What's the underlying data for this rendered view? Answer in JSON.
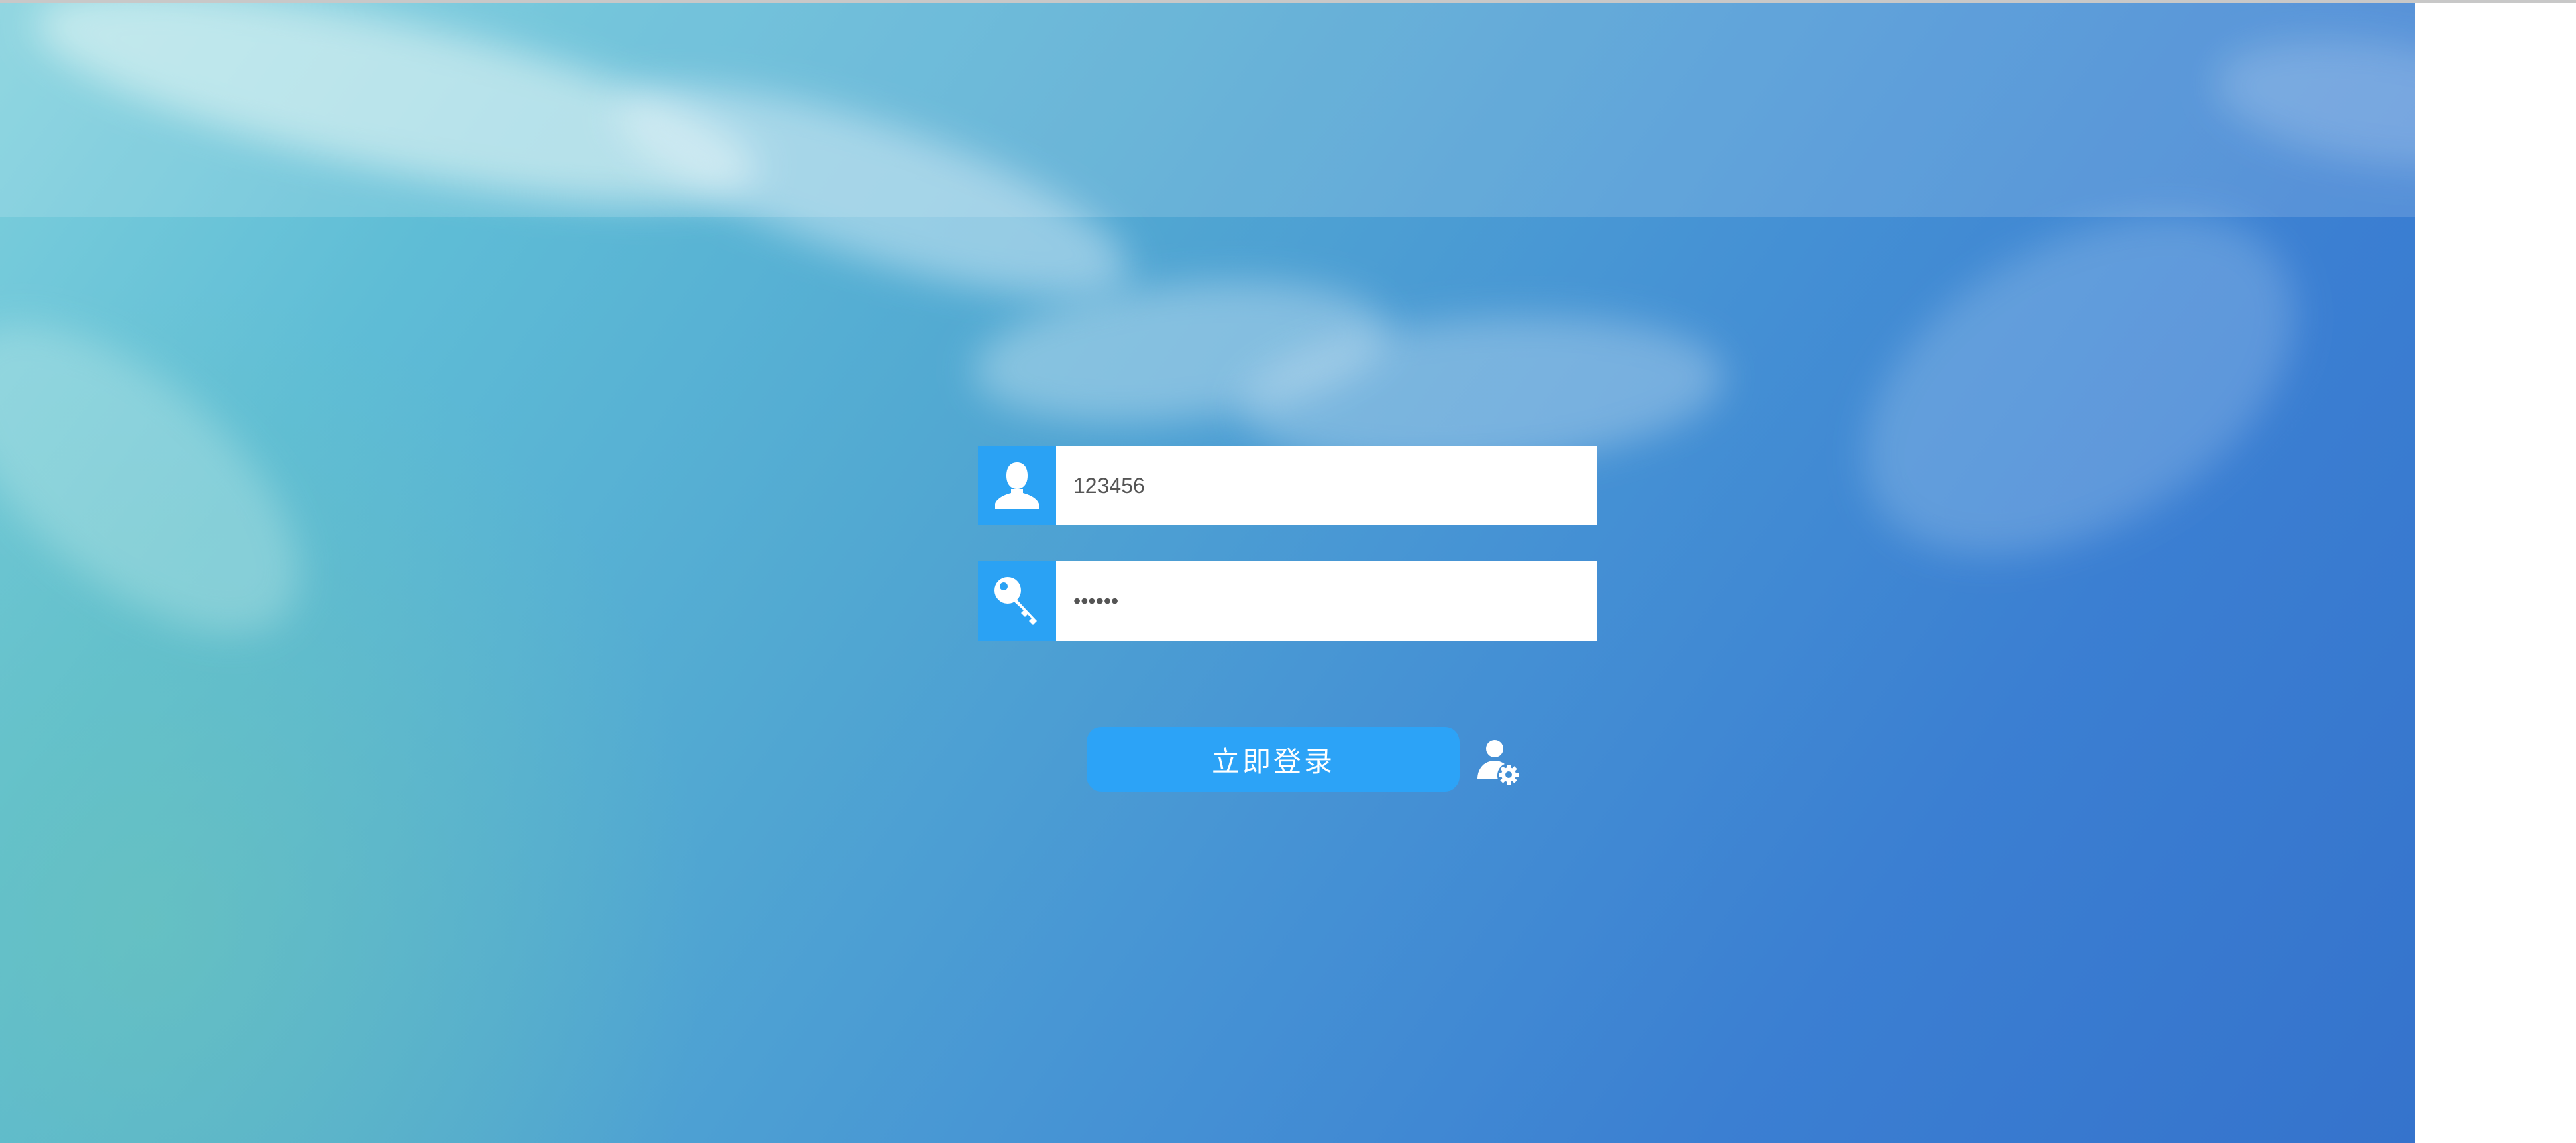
{
  "login": {
    "username": {
      "icon": "user-icon",
      "value": "123456"
    },
    "password": {
      "icon": "key-icon",
      "value": "123456"
    },
    "submit_label": "立即登录",
    "admin_icon": "user-settings-icon"
  },
  "colors": {
    "accent": "#2aa2f4",
    "button": "#2ca3f7",
    "input_background": "#ffffff",
    "input_text": "#555555"
  }
}
